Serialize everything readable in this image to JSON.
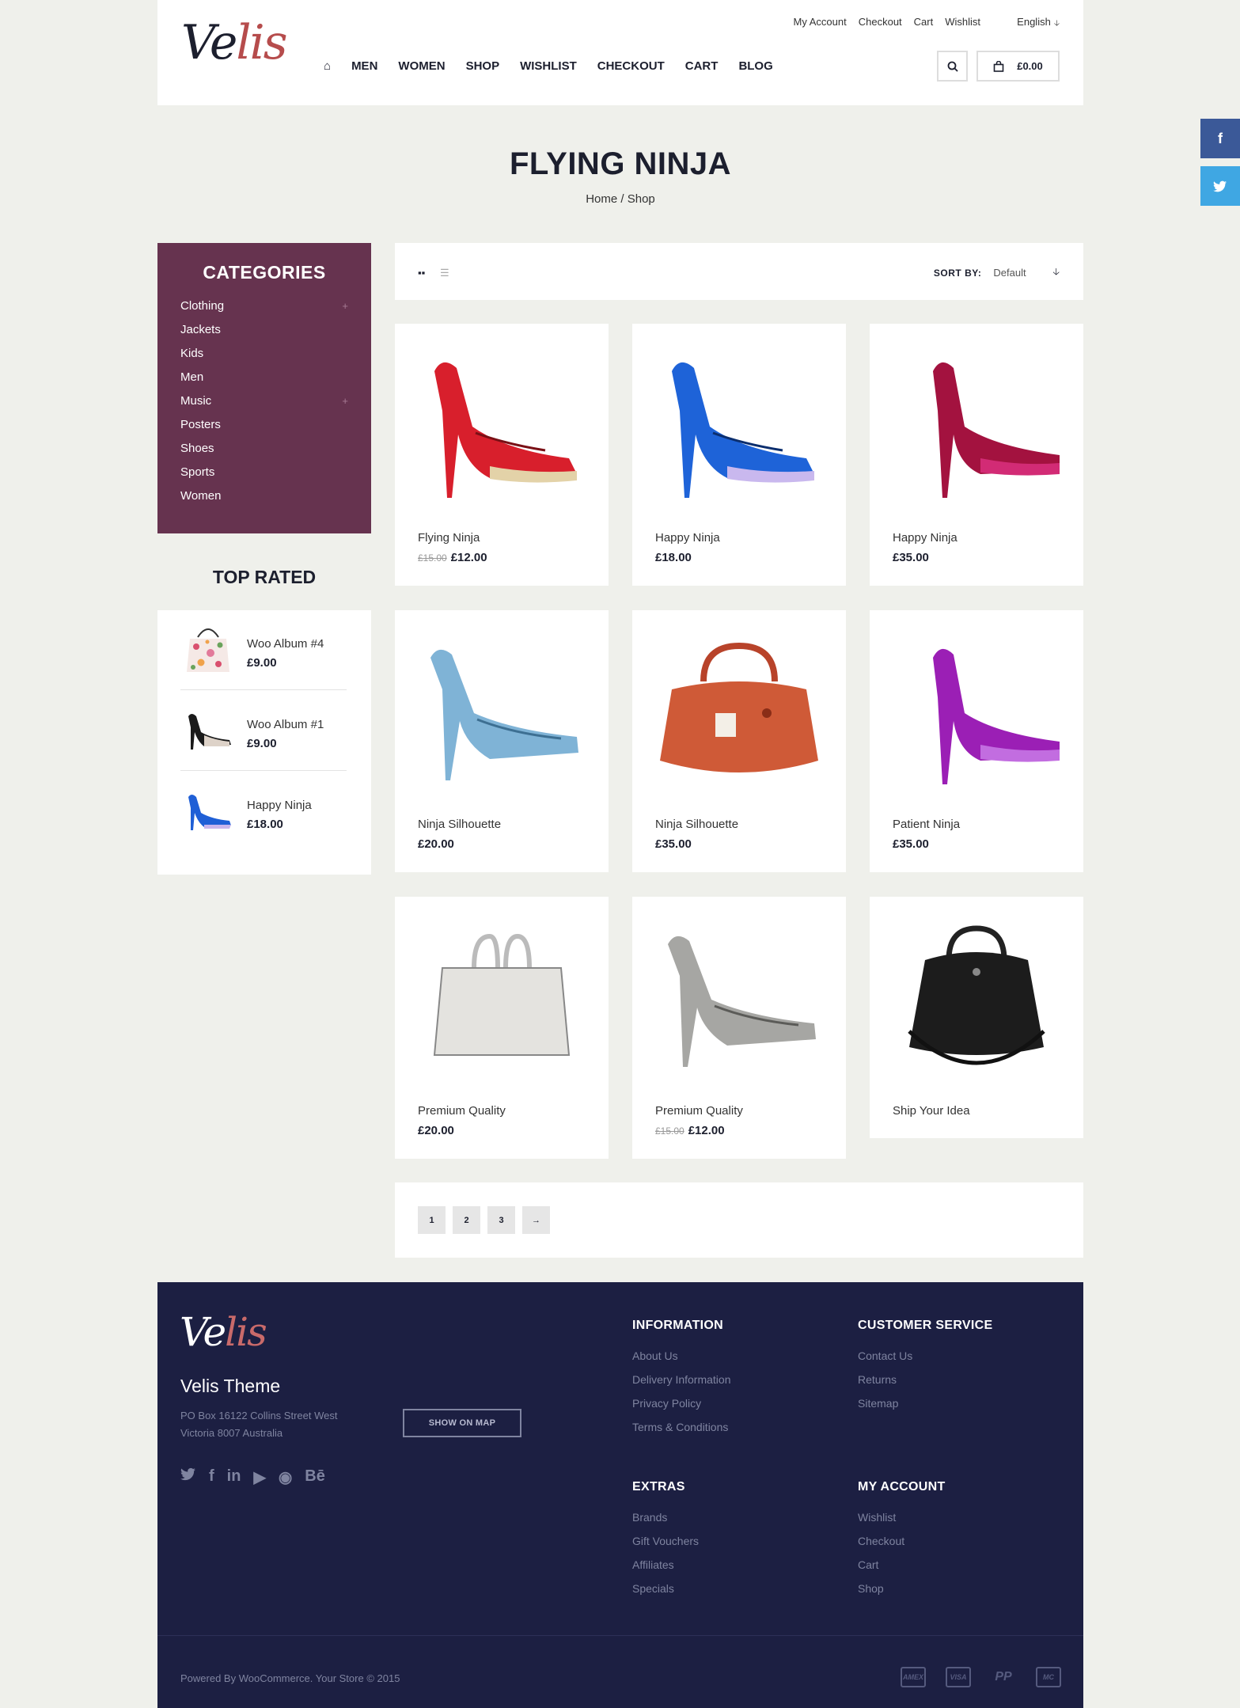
{
  "brand": {
    "logo_main": "Ve",
    "logo_accent": "lis"
  },
  "toplinks": [
    "My Account",
    "Checkout",
    "Cart",
    "Wishlist"
  ],
  "language": {
    "label": "English",
    "arrow": "🡣"
  },
  "nav": {
    "home_icon": "⌂",
    "items": [
      "MEN",
      "WOMEN",
      "SHOP",
      "WISHLIST",
      "CHECKOUT",
      "CART",
      "BLOG"
    ]
  },
  "cart": {
    "total": "£0.00",
    "search_icon": "⌕",
    "cart_icon": "⊓"
  },
  "side_social": {
    "facebook": "f",
    "twitter": "t"
  },
  "page": {
    "title": "FLYING NINJA",
    "breadcrumb": "Home / Shop"
  },
  "categories": {
    "title": "CATEGORIES",
    "items": [
      {
        "label": "Clothing",
        "expand": "+"
      },
      {
        "label": "Jackets",
        "expand": ""
      },
      {
        "label": "Kids",
        "expand": ""
      },
      {
        "label": "Men",
        "expand": ""
      },
      {
        "label": "Music",
        "expand": "+"
      },
      {
        "label": "Posters",
        "expand": ""
      },
      {
        "label": "Shoes",
        "expand": ""
      },
      {
        "label": "Sports",
        "expand": ""
      },
      {
        "label": "Women",
        "expand": ""
      }
    ]
  },
  "top_rated": {
    "title": "TOP RATED",
    "items": [
      {
        "name": "Woo Album #4",
        "price": "£9.00"
      },
      {
        "name": "Woo Album #1",
        "price": "£9.00"
      },
      {
        "name": "Happy Ninja",
        "price": "£18.00"
      }
    ]
  },
  "toolbar": {
    "grid_icon": "▪▪",
    "list_icon": "☰",
    "sort_label": "SORT BY:",
    "sort_value": "Default",
    "sort_arrow": "🡣"
  },
  "products": [
    {
      "name": "Flying Ninja",
      "old_price": "£15.00",
      "price": "£12.00"
    },
    {
      "name": "Happy Ninja",
      "old_price": "",
      "price": "£18.00"
    },
    {
      "name": "Happy Ninja",
      "old_price": "",
      "price": "£35.00"
    },
    {
      "name": "Ninja Silhouette",
      "old_price": "",
      "price": "£20.00"
    },
    {
      "name": "Ninja Silhouette",
      "old_price": "",
      "price": "£35.00"
    },
    {
      "name": "Patient Ninja",
      "old_price": "",
      "price": "£35.00"
    },
    {
      "name": "Premium Quality",
      "old_price": "",
      "price": "£20.00"
    },
    {
      "name": "Premium Quality",
      "old_price": "£15.00",
      "price": "£12.00"
    },
    {
      "name": "Ship Your Idea",
      "old_price": "",
      "price": ""
    }
  ],
  "pagination": [
    "1",
    "2",
    "3",
    "→"
  ],
  "footer": {
    "logo_main": "Ve",
    "logo_accent": "lis",
    "name": "Velis Theme",
    "address": "PO Box 16122 Collins Street West Victoria 8007 Australia",
    "show_map": "SHOW ON MAP",
    "social": [
      "twitter-icon",
      "facebook-icon",
      "linkedin-icon",
      "youtube-icon",
      "github-icon",
      "behance-icon"
    ],
    "social_glyphs": [
      "🐦",
      "f",
      "in",
      "▶",
      "◉",
      "Bē"
    ],
    "columns": [
      {
        "title": "INFORMATION",
        "links": [
          "About Us",
          "Delivery Information",
          "Privacy Policy",
          "Terms & Conditions"
        ]
      },
      {
        "title": "CUSTOMER SERVICE",
        "links": [
          "Contact Us",
          "Returns",
          "Sitemap"
        ]
      },
      {
        "title": "EXTRAS",
        "links": [
          "Brands",
          "Gift Vouchers",
          "Affiliates",
          "Specials"
        ]
      },
      {
        "title": "MY ACCOUNT",
        "links": [
          "Wishlist",
          "Checkout",
          "Cart",
          "Shop"
        ]
      }
    ],
    "copyright": "Powered By WooCommerce. Your Store © 2015",
    "payments": [
      "AMEX",
      "VISA",
      "PP",
      "MC"
    ]
  }
}
